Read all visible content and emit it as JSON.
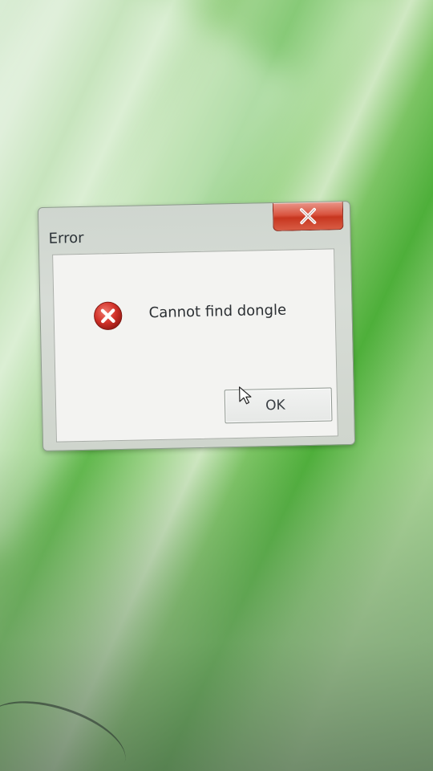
{
  "window": {
    "title": "Error"
  },
  "dialog": {
    "message": "Cannot find dongle",
    "ok_label": "OK",
    "icons": {
      "close": "close-icon",
      "error": "error-icon",
      "cursor": "mouse-cursor-icon"
    }
  },
  "colors": {
    "close_button": "#d9543f",
    "error_icon": "#d2322a",
    "desktop_green": "#5fb84a"
  }
}
